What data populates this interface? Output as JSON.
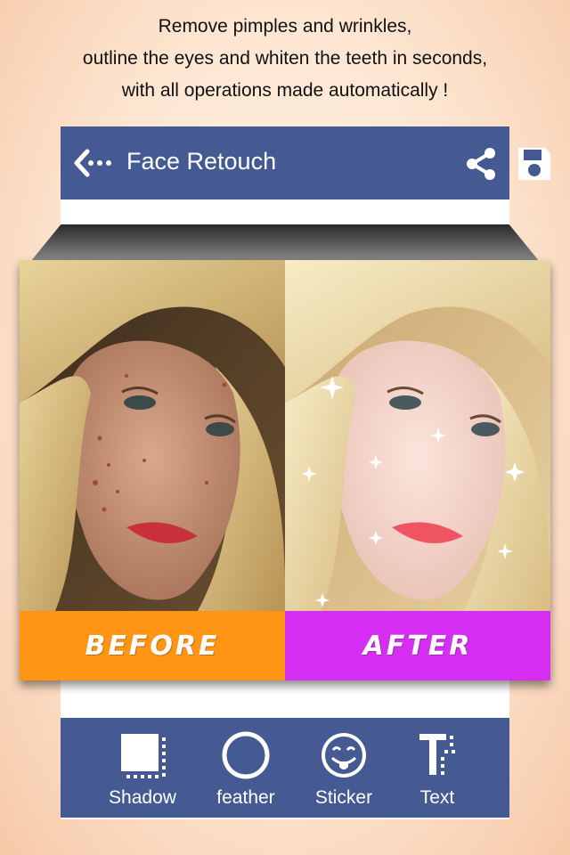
{
  "promo": {
    "line1": "Remove pimples and wrinkles,",
    "line2": "outline the eyes and whiten the teeth in seconds,",
    "line3": "with all operations made automatically !"
  },
  "appbar": {
    "title": "Face Retouch",
    "back_icon": "back-arrow-icon",
    "share_icon": "share-icon",
    "save_icon": "save-icon",
    "color": "#455a92"
  },
  "comparison": {
    "before_label": "BEFORE",
    "after_label": "AFTER",
    "before_color": "#ff9415",
    "after_color": "#d52ef2"
  },
  "toolbar": {
    "items": [
      {
        "label": "Shadow",
        "icon": "shadow-icon"
      },
      {
        "label": "feather",
        "icon": "feather-icon"
      },
      {
        "label": "Sticker",
        "icon": "sticker-icon"
      },
      {
        "label": "Text",
        "icon": "text-icon"
      }
    ]
  }
}
